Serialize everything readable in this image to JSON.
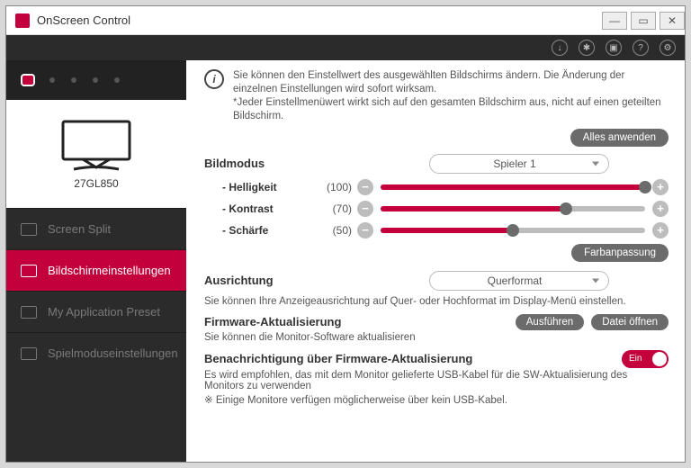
{
  "window": {
    "title": "OnScreen Control"
  },
  "sidebar": {
    "monitor_name": "27GL850",
    "items": [
      {
        "label": "Screen Split"
      },
      {
        "label": "Bildschirmeinstellungen"
      },
      {
        "label": "My Application Preset"
      },
      {
        "label": "Spielmoduseinstellungen"
      }
    ]
  },
  "info": {
    "line1": "Sie können den Einstellwert des ausgewählten Bildschirms ändern. Die Änderung der einzelnen Einstellungen wird sofort wirksam.",
    "line2": "*Jeder Einstellmenüwert wirkt sich auf den gesamten Bildschirm aus, nicht auf einen geteilten Bildschirm."
  },
  "buttons": {
    "apply_all": "Alles anwenden",
    "color_adjust": "Farbanpassung",
    "run": "Ausführen",
    "open_file": "Datei öffnen"
  },
  "picture_mode": {
    "label": "Bildmodus",
    "value": "Spieler 1",
    "sliders": [
      {
        "label": "- Helligkeit",
        "value": 100,
        "display": "(100)"
      },
      {
        "label": "- Kontrast",
        "value": 70,
        "display": "(70)"
      },
      {
        "label": "- Schärfe",
        "value": 50,
        "display": "(50)"
      }
    ]
  },
  "orientation": {
    "label": "Ausrichtung",
    "value": "Querformat",
    "desc": "Sie können Ihre Anzeigeausrichtung auf Quer- oder Hochformat im Display-Menü einstellen."
  },
  "firmware": {
    "label": "Firmware-Aktualisierung",
    "desc": "Sie können die Monitor-Software aktualisieren"
  },
  "notify": {
    "label": "Benachrichtigung über Firmware-Aktualisierung",
    "toggle": "Ein",
    "desc1": "Es wird empfohlen, das mit dem Monitor gelieferte USB-Kabel für die SW-Aktualisierung des Monitors zu verwenden",
    "desc2": "※ Einige Monitore verfügen möglicherweise über kein USB-Kabel."
  }
}
